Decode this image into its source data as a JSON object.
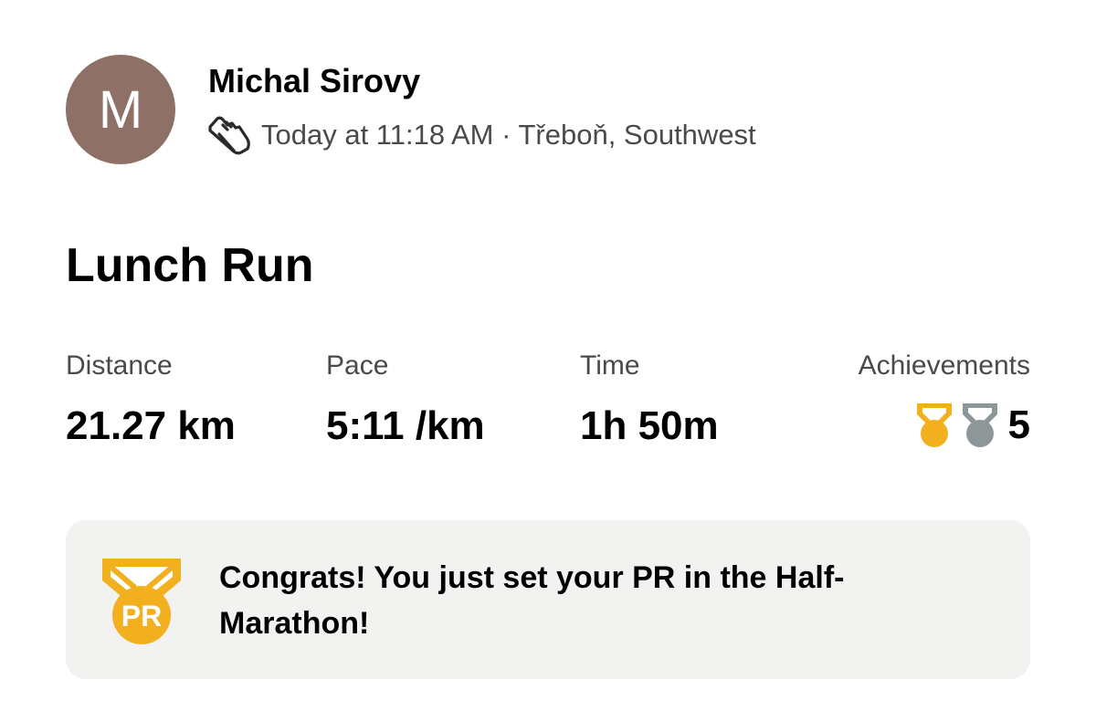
{
  "header": {
    "avatar_initial": "M",
    "avatar_color": "#8f7066",
    "athlete_name": "Michal Sirovy",
    "activity_icon": "running-shoe-icon",
    "meta": "Today at 11:18 AM · Třeboň, Southwest"
  },
  "activity": {
    "title": "Lunch Run"
  },
  "stats": {
    "distance": {
      "label": "Distance",
      "value": "21.27 km"
    },
    "pace": {
      "label": "Pace",
      "value": "5:11 /km"
    },
    "time": {
      "label": "Time",
      "value": "1h 50m"
    },
    "achievements": {
      "label": "Achievements",
      "icons": [
        "gold-medal-icon",
        "silver-medal-icon"
      ],
      "count": "5"
    }
  },
  "pr_banner": {
    "icon": "pr-medal-icon",
    "icon_text": "PR",
    "message": "Congrats! You just set your PR in the Half-Marathon!"
  },
  "colors": {
    "gold": "#f2b01e",
    "silver": "#8d9699",
    "banner_bg": "#f2f2f1",
    "meta_text": "#4a4a4a"
  }
}
